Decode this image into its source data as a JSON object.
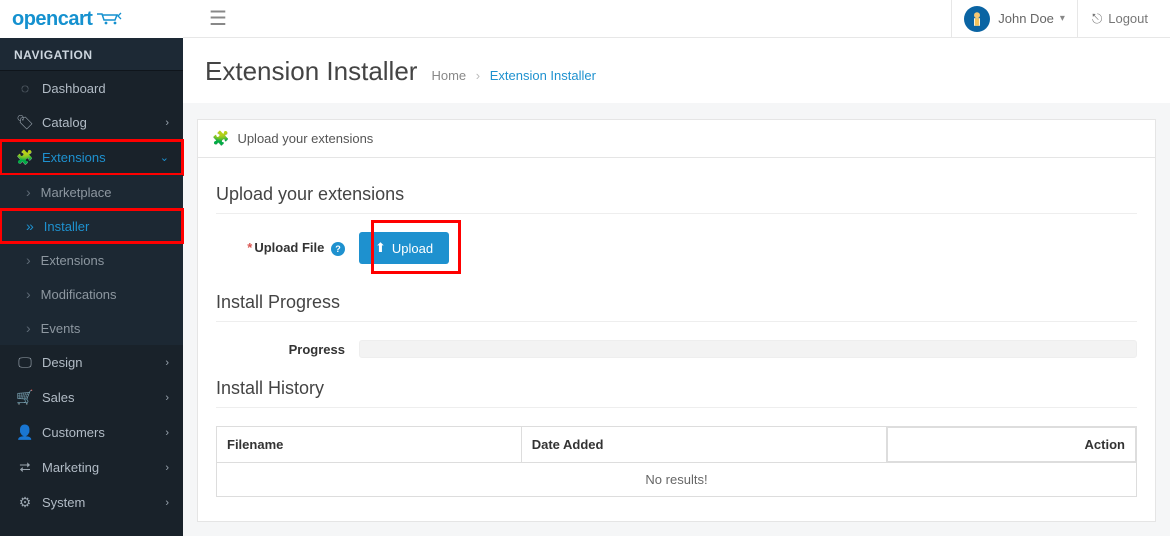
{
  "brand": "opencart",
  "nav_header": "NAVIGATION",
  "sidebar": {
    "items": [
      {
        "label": "Dashboard",
        "icon": "dashboard"
      },
      {
        "label": "Catalog",
        "icon": "tag",
        "expandable": true
      },
      {
        "label": "Extensions",
        "icon": "puzzle",
        "expandable": true,
        "open": true
      },
      {
        "label": "Design",
        "icon": "monitor",
        "expandable": true
      },
      {
        "label": "Sales",
        "icon": "cart",
        "expandable": true
      },
      {
        "label": "Customers",
        "icon": "user",
        "expandable": true
      },
      {
        "label": "Marketing",
        "icon": "share",
        "expandable": true
      },
      {
        "label": "System",
        "icon": "gear",
        "expandable": true
      }
    ],
    "extensions_sub": [
      {
        "label": "Marketplace"
      },
      {
        "label": "Installer",
        "active": true
      },
      {
        "label": "Extensions"
      },
      {
        "label": "Modifications"
      },
      {
        "label": "Events"
      }
    ]
  },
  "user": {
    "name": "John Doe"
  },
  "logout_label": "Logout",
  "page": {
    "title": "Extension Installer",
    "breadcrumb_home": "Home",
    "breadcrumb_current": "Extension Installer"
  },
  "panel": {
    "title": "Upload your extensions",
    "section_upload": "Upload your extensions",
    "upload_label": "Upload File",
    "upload_button": "Upload",
    "section_progress": "Install Progress",
    "progress_label": "Progress",
    "section_history": "Install History",
    "table": {
      "cols": [
        "Filename",
        "Date Added",
        "Action"
      ],
      "empty": "No results!"
    }
  }
}
